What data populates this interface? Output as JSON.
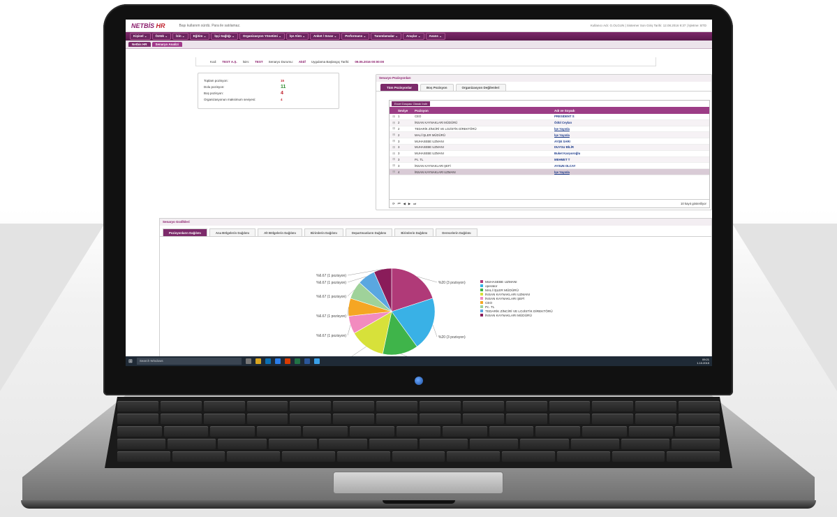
{
  "app": {
    "logo_prefix": "NETBİS",
    "logo_suffix": " HR",
    "tagline": "Başı kullanım sürdü. Para ile satılamaz.",
    "userinfo": "Kullanıcı Adı: G.OLGUN | Sistemer Son Giriş Tarihi: 12.08.2016 9:37 | İşletme: BTD"
  },
  "menu": [
    "Kişisel",
    "Öztük",
    "İzin",
    "Eğitim",
    "İşçi Sağlığı",
    "Organizasyon Yönetimi",
    "İşe Alım",
    "Anket / Sınav",
    "Performans",
    "Tanımlamalar",
    "Araçlar",
    "Avans"
  ],
  "breadcrumbs": [
    "Netbis HR",
    "Senaryo Analizi"
  ],
  "info": {
    "kod_label": "Kod:",
    "kod_value": "TEST A.Ş.",
    "isim_label": "İsim:",
    "isim_value": "TEST",
    "durum_label": "Senaryo Durumu:",
    "durum_value": "Aktif",
    "tarih_label": "Uygulama Başlangıç Tarihi:",
    "tarih_value": "09.05.2016 00:00:00"
  },
  "counts": [
    {
      "label": "Toplam pozisyon:",
      "value": "15"
    },
    {
      "label": "Dolu pozisyon:",
      "value": "11"
    },
    {
      "label": "Boş pozisyon:",
      "value": "4"
    },
    {
      "label": "Organizasyonun maksimum seviyesi:",
      "value": "4"
    }
  ],
  "positions_panel": {
    "title": "Senaryo Pozisyonları",
    "tabs": [
      "Tüm Pozisyonlar",
      "Boş Pozisyon",
      "Organizasyon Değilenleri"
    ],
    "excel_button": "Excel Dosyası Olarak İndir",
    "headers": [
      "Seviye",
      "Pozisyon",
      "Adı ve Soyadı"
    ],
    "rows": [
      {
        "level": "1",
        "position": "CEO",
        "name": "PRESIDENT S",
        "link": false
      },
      {
        "level": "2",
        "position": "İNSAN KAYNAKLARI MÜDÜRÜ",
        "name": "Ödül Ceylan",
        "link": false
      },
      {
        "level": "2",
        "position": "TEDARİK ZİNCİRİ VE LOJİSTİK DİREKTÖRÜ",
        "name": "İşe Yayınla",
        "link": true
      },
      {
        "level": "2",
        "position": "MALİ İŞLER MÜDÜRÜ",
        "name": "İşe Yayınla",
        "link": true
      },
      {
        "level": "3",
        "position": "MUHASEBE UZMANI",
        "name": "AYŞE SARI",
        "link": false
      },
      {
        "level": "3",
        "position": "MUHASEBE UZMANI",
        "name": "DUYGU BİLİR",
        "link": false
      },
      {
        "level": "3",
        "position": "MUHASEBE UZMANI",
        "name": "Buket Karşıoroğlu",
        "link": false
      },
      {
        "level": "3",
        "position": "Pc. TL",
        "name": "MEHMET T",
        "link": false
      },
      {
        "level": "3",
        "position": "İNSAN KAYNAKLARI ŞEFİ",
        "name": "AYSUN OLCAY",
        "link": false
      },
      {
        "level": "4",
        "position": "İNSAN KAYNAKLARI UZMANI",
        "name": "İşe Yayınla",
        "link": true
      }
    ],
    "footer_count": "10 kayıt gösteriliyor"
  },
  "charts_panel": {
    "title": "Senaryo Grafikleri",
    "tabs": [
      "Pozisyonların Dağılımı",
      "Ana Bölgelerin Dağılımı",
      "Alt Bölgelerin Dağılımı",
      "Birimlerin Dağılımı",
      "Departmanların Dağılımı",
      "Birimlerin Dağılımı",
      "Derecelerin Dağılımı"
    ]
  },
  "chart_data": {
    "type": "pie",
    "slices": [
      {
        "name": "MUHASEBE UZMANI",
        "value": 20,
        "label": "%20 (3 pozisyon)",
        "color": "#b03a78"
      },
      {
        "name": "operator",
        "value": 20,
        "label": "%20 (3 pozisyon)",
        "color": "#39b1e6"
      },
      {
        "name": "MALİ İŞLER MÜDÜRÜ",
        "value": 13.33,
        "label": "%13.33 (2 pozisyon)",
        "color": "#3fb44a"
      },
      {
        "name": "İNSAN KAYNAKLARI UZMANI",
        "value": 13.33,
        "label": "%13.33 (2 pozisyon)",
        "color": "#d7e13a"
      },
      {
        "name": "İNSAN KAYNAKLARI ŞEFİ",
        "value": 6.67,
        "label": "%6.67 (1 pozisyon)",
        "color": "#f28bbf"
      },
      {
        "name": "CEO",
        "value": 6.67,
        "label": "%6.67 (1 pozisyon)",
        "color": "#f5a623"
      },
      {
        "name": "Pc. TL",
        "value": 6.67,
        "label": "%6.67 (1 pozisyon)",
        "color": "#9fd29a"
      },
      {
        "name": "TEDARİK ZİNCİRİ VE LOJİSTİK DİREKTÖRÜ",
        "value": 6.67,
        "label": "%6.67 (1 pozisyon)",
        "color": "#5aa7e0"
      },
      {
        "name": "İNSAN KAYNAKLARI MÜDÜRÜ",
        "value": 6.67,
        "label": "%6.67 (1 pozisyon)",
        "color": "#8a1c5a"
      }
    ]
  },
  "taskbar": {
    "search_placeholder": "Search Windows",
    "time": "09:21",
    "date": "1.10.2015"
  }
}
